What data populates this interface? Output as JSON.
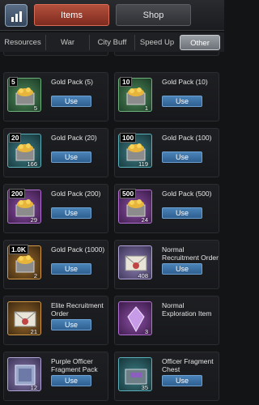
{
  "header": {
    "tabs": [
      {
        "label": "Items",
        "active": true
      },
      {
        "label": "Shop",
        "active": false
      }
    ]
  },
  "subtabs": [
    "Resources",
    "War",
    "City Buff",
    "Speed Up",
    "Other"
  ],
  "active_subtab": "Other",
  "items": [
    {
      "name": "Gold Pack (5)",
      "badge": "5",
      "count": "5",
      "use": "Use",
      "theme": "green",
      "icon": "gold-chest-icon"
    },
    {
      "name": "Gold Pack (10)",
      "badge": "10",
      "count": "1",
      "use": "Use",
      "theme": "green",
      "icon": "gold-chest-icon"
    },
    {
      "name": "Gold Pack (20)",
      "badge": "20",
      "count": "166",
      "use": "Use",
      "theme": "teal",
      "icon": "gold-chest-icon"
    },
    {
      "name": "Gold Pack (100)",
      "badge": "100",
      "count": "119",
      "use": "Use",
      "theme": "teal",
      "icon": "gold-chest-icon"
    },
    {
      "name": "Gold Pack (200)",
      "badge": "200",
      "count": "29",
      "use": "Use",
      "theme": "purple",
      "icon": "gold-chest-icon"
    },
    {
      "name": "Gold Pack (500)",
      "badge": "500",
      "count": "24",
      "use": "Use",
      "theme": "purple",
      "icon": "gold-chest-icon"
    },
    {
      "name": "Gold Pack (1000)",
      "badge": "1.0K",
      "count": "2",
      "use": "Use",
      "theme": "gold",
      "icon": "gold-chest-icon"
    },
    {
      "name": "Normal Recruitment Order",
      "badge": "",
      "count": "408",
      "use": "Use",
      "theme": "lav",
      "icon": "envelope-icon"
    },
    {
      "name": "Elite Recruitment Order",
      "badge": "",
      "count": "21",
      "use": "Use",
      "theme": "gold",
      "icon": "envelope-icon"
    },
    {
      "name": "Normal Exploration Item",
      "badge": "",
      "count": "3",
      "use": "",
      "theme": "purple",
      "icon": "crystal-icon"
    },
    {
      "name": "Purple Officer Fragment Pack",
      "badge": "",
      "count": "12",
      "use": "Use",
      "theme": "lav",
      "icon": "fragment-pack-icon"
    },
    {
      "name": "Officer Fragment Chest",
      "badge": "",
      "count": "35",
      "use": "Use",
      "theme": "teal",
      "icon": "fragment-chest-icon"
    }
  ]
}
